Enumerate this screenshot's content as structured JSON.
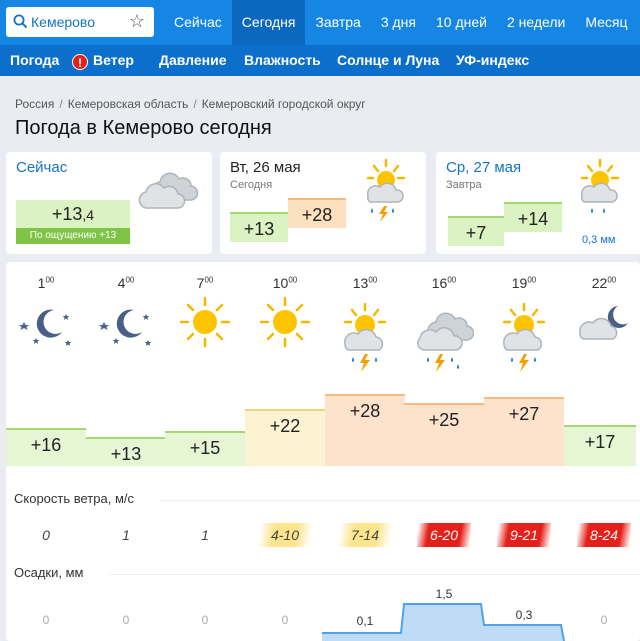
{
  "search": {
    "value": "Кемерово"
  },
  "tabs": [
    "Сейчас",
    "Сегодня",
    "Завтра",
    "3 дня",
    "10 дней",
    "2 недели",
    "Месяц"
  ],
  "active_tab": "Сегодня",
  "subtabs": [
    "Погода",
    "Ветер",
    "Давление",
    "Влажность",
    "Солнце и Луна",
    "УФ-индекс"
  ],
  "breadcrumb": [
    "Россия",
    "Кемеровская область",
    "Кемеровский городской округ"
  ],
  "page_title": "Погода в Кемерово сегодня",
  "now": {
    "label": "Сейчас",
    "temp_main": "+13",
    "temp_frac": ",4",
    "feels": "По ощущению +13",
    "icon": "cloudy-icon"
  },
  "today": {
    "date": "Вт, 26 мая",
    "sub": "Сегодня",
    "min": "+13",
    "max": "+28",
    "icon": "thunderstorm-icon"
  },
  "tomorrow": {
    "date": "Ср, 27 мая",
    "sub": "Завтра",
    "min": "+7",
    "max": "+14",
    "precip": "0,3 мм",
    "icon": "sun-cloud-rain-icon"
  },
  "hours": [
    {
      "h": "1",
      "icon": "moon-stars",
      "temp": "+16",
      "wind": "0",
      "precip": "0"
    },
    {
      "h": "4",
      "icon": "moon-stars",
      "temp": "+13",
      "wind": "1",
      "precip": "0"
    },
    {
      "h": "7",
      "icon": "sun",
      "temp": "+15",
      "wind": "1",
      "precip": "0"
    },
    {
      "h": "10",
      "icon": "sun",
      "temp": "+22",
      "wind": "4-10",
      "precip": "0"
    },
    {
      "h": "13",
      "icon": "sun-cloud-storm",
      "temp": "+28",
      "wind": "7-14",
      "precip": "0,1"
    },
    {
      "h": "16",
      "icon": "cloud-storm",
      "temp": "+25",
      "wind": "6-20",
      "precip": "1,5"
    },
    {
      "h": "19",
      "icon": "sun-cloud-storm",
      "temp": "+27",
      "wind": "9-21",
      "precip": "0,3"
    },
    {
      "h": "22",
      "icon": "moon-cloud",
      "temp": "+17",
      "wind": "8-24",
      "precip": "0"
    }
  ],
  "wind_label": "Скорость ветра, м/с",
  "precip_label": "Осадки, мм",
  "colors": {
    "nav": "#1586e4",
    "nav_dark": "#0c6fcb",
    "green": "#dbf3c2",
    "orange": "#fde0c0",
    "red": "#e5201a",
    "yellow": "#fde58e"
  }
}
